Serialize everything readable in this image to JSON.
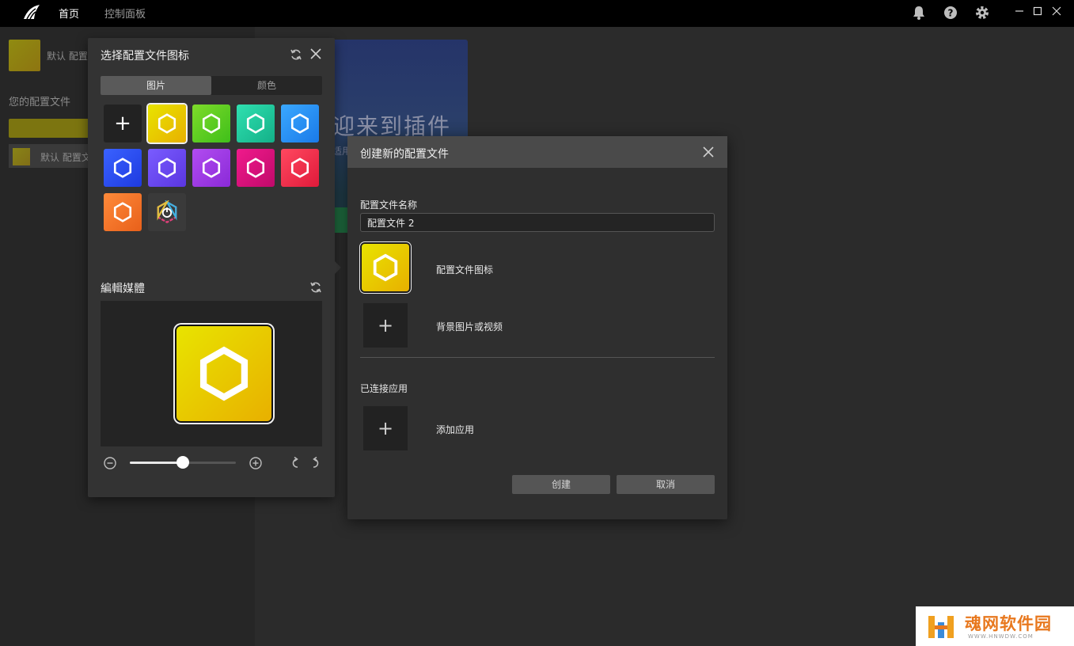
{
  "topbar": {
    "nav_home": "首页",
    "nav_dashboard": "控制面板",
    "icons": [
      "bell-icon",
      "help-icon",
      "gear-icon",
      "minimize-icon",
      "maximize-icon",
      "close-icon"
    ]
  },
  "sidebar": {
    "current_profile": "默认 配置",
    "section_title": "您的配置文件",
    "profile_item": "默认 配置文"
  },
  "welcome": {
    "title": "迎来到插件",
    "subtitle": "适用"
  },
  "picker": {
    "title": "选择配置文件图标",
    "tabs": [
      "图片",
      "颜色"
    ],
    "active_tab": "图片",
    "tiles": [
      {
        "kind": "add",
        "glyph": "+"
      },
      {
        "kind": "hex",
        "color_a": "#e8e400",
        "color_b": "#e8b000",
        "selected": true
      },
      {
        "kind": "hex",
        "color_a": "#7edb2a",
        "color_b": "#3fbf1a"
      },
      {
        "kind": "hex",
        "color_a": "#2fe0b0",
        "color_b": "#14b088"
      },
      {
        "kind": "hex",
        "color_a": "#3aa8ff",
        "color_b": "#1a7ae8"
      },
      {
        "kind": "hex",
        "color_a": "#3a62ff",
        "color_b": "#1e3ae0"
      },
      {
        "kind": "hex",
        "color_a": "#7a5cff",
        "color_b": "#5a36e0"
      },
      {
        "kind": "hex",
        "color_a": "#b24cf0",
        "color_b": "#8a2ad8"
      },
      {
        "kind": "hex",
        "color_a": "#f01a8c",
        "color_b": "#c00a6a"
      },
      {
        "kind": "hex",
        "color_a": "#ff4860",
        "color_b": "#e01a3a"
      },
      {
        "kind": "hex",
        "color_a": "#ff8a3a",
        "color_b": "#e8601a"
      },
      {
        "kind": "icue",
        "color_a": "#3a3a3a",
        "color_b": "#3a3a3a"
      }
    ],
    "edit_title": "編輯媒體",
    "zoom_level": 0.5
  },
  "dialog": {
    "title": "创建新的配置文件",
    "name_label": "配置文件名称",
    "name_value": "配置文件 2",
    "icon_label": "配置文件图标",
    "bg_label": "背景图片或视频",
    "apps_section": "已连接应用",
    "add_app_label": "添加应用",
    "add_glyph": "+",
    "create_button": "创建",
    "cancel_button": "取消"
  },
  "watermark": {
    "text": "魂网软件园",
    "sub": "WWW.HNWDW.COM"
  },
  "colors": {
    "accent_yellow": "#e8d000",
    "panel_bg": "#333333",
    "dialog_header": "#4a4a4a"
  }
}
